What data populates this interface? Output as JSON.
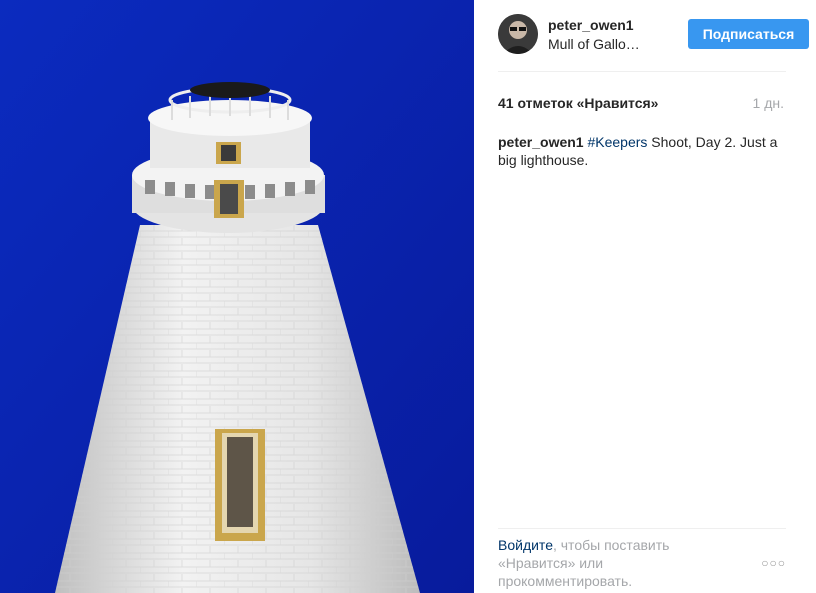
{
  "post": {
    "username": "peter_owen1",
    "location": "Mull of Gallo…",
    "follow_label": "Подписаться",
    "likes": "41 отметок «Нравится»",
    "age": "1 дн.",
    "caption_user": "peter_owen1",
    "caption_hashtag": "#Keepers",
    "caption_text": " Shoot, Day 2. Just a big lighthouse.",
    "login_link": "Войдите",
    "login_rest": ", чтобы поставить «Нравится» или прокомментировать.",
    "more_glyph": "○○○"
  },
  "colors": {
    "sky": "#0a1fa8",
    "follow_button": "#3897f0",
    "link": "#003569",
    "muted": "#a5a7aa"
  },
  "icons": {
    "more": "more-options-icon",
    "photo": "lighthouse-photo"
  }
}
